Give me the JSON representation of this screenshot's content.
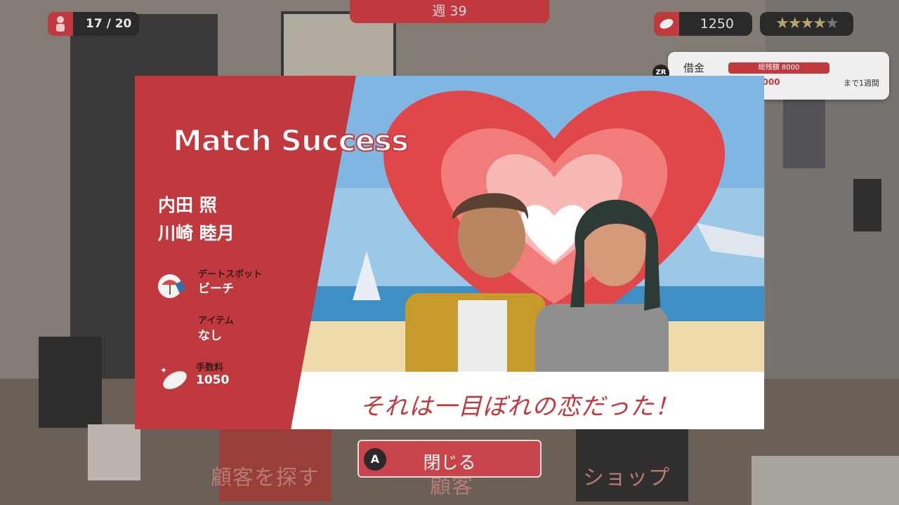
{
  "hud": {
    "customers": "17 / 20",
    "week": "週 39",
    "money": "1250",
    "rating_stars": 4.5,
    "loan": {
      "label": "借金",
      "bar_text": "総残額 8000",
      "amount": ".000",
      "due": "まで1週間"
    }
  },
  "bottom_menu": {
    "find": "顧客を探す",
    "customer": "顧客",
    "shop": "ショップ"
  },
  "result": {
    "title": "Match Success",
    "names": [
      "内田 照",
      "川崎 睦月"
    ],
    "date_spot_label": "デートスポット",
    "date_spot_value": "ビーチ",
    "item_label": "アイテム",
    "item_value": "なし",
    "fee_label": "手数料",
    "fee_value": "1050",
    "tagline": "それは一目ぼれの恋だった！"
  },
  "close_button": {
    "badge": "A",
    "label": "閉じる"
  },
  "colors": {
    "accent_red": "#c0393e",
    "heart_outer": "#e0474a",
    "heart_mid": "#f07d7a",
    "heart_inner": "#f8b8b4"
  }
}
